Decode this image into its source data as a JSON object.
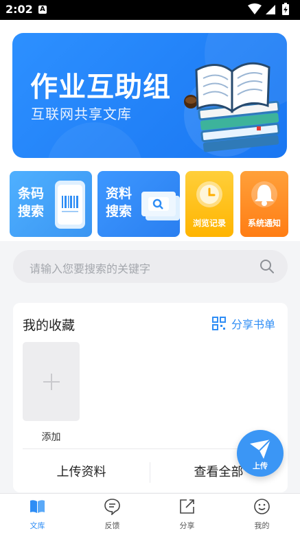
{
  "status": {
    "time": "2:02",
    "notification_badge": "A"
  },
  "banner": {
    "title": "作业互助组",
    "subtitle": "互联网共享文库"
  },
  "quick_actions": {
    "barcode": {
      "label": "条码搜索"
    },
    "doc": {
      "label": "资料搜索"
    },
    "history": {
      "label": "浏览记录"
    },
    "notice": {
      "label": "系统通知"
    }
  },
  "search": {
    "placeholder": "请输入您要搜索的关键字"
  },
  "favorites": {
    "title": "我的收藏",
    "share_label": "分享书单",
    "add_label": "添加",
    "upload_label": "上传资料",
    "view_all_label": "查看全部"
  },
  "fab": {
    "label": "上传"
  },
  "tabs": [
    {
      "label": "文库",
      "icon": "book-icon",
      "active": true
    },
    {
      "label": "反馈",
      "icon": "chat-icon",
      "active": false
    },
    {
      "label": "分享",
      "icon": "share-icon",
      "active": false
    },
    {
      "label": "我的",
      "icon": "smile-icon",
      "active": false
    }
  ],
  "colors": {
    "accent": "#2e8df5",
    "yellow": "#ffb400",
    "orange": "#ff7d14"
  }
}
